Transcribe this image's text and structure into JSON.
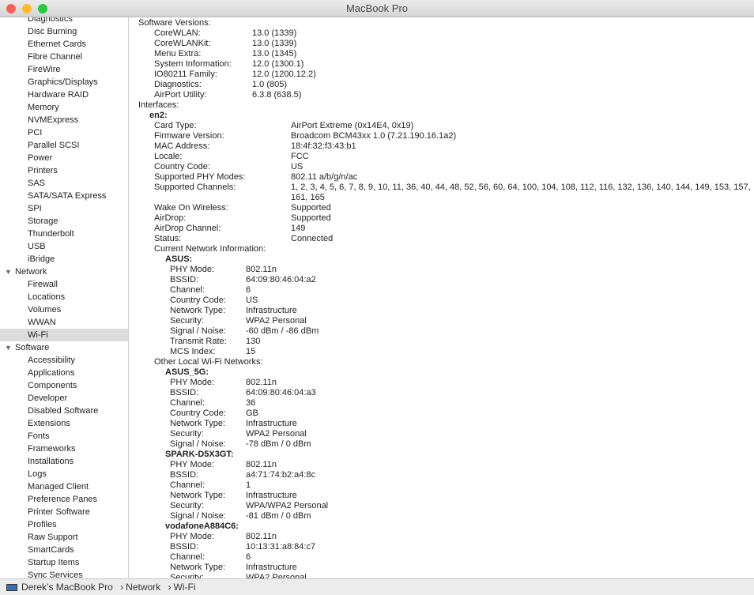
{
  "window": {
    "title": "MacBook Pro",
    "traffic": {
      "close": "#fc5f57",
      "minimize": "#fdbc2e",
      "zoom": "#28c840"
    }
  },
  "sidebar": {
    "items": [
      {
        "label": "Diagnostics",
        "level": 1
      },
      {
        "label": "Disc Burning",
        "level": 1
      },
      {
        "label": "Ethernet Cards",
        "level": 1
      },
      {
        "label": "Fibre Channel",
        "level": 1
      },
      {
        "label": "FireWire",
        "level": 1
      },
      {
        "label": "Graphics/Displays",
        "level": 1
      },
      {
        "label": "Hardware RAID",
        "level": 1
      },
      {
        "label": "Memory",
        "level": 1
      },
      {
        "label": "NVMExpress",
        "level": 1
      },
      {
        "label": "PCI",
        "level": 1
      },
      {
        "label": "Parallel SCSI",
        "level": 1
      },
      {
        "label": "Power",
        "level": 1
      },
      {
        "label": "Printers",
        "level": 1
      },
      {
        "label": "SAS",
        "level": 1
      },
      {
        "label": "SATA/SATA Express",
        "level": 1
      },
      {
        "label": "SPI",
        "level": 1
      },
      {
        "label": "Storage",
        "level": 1
      },
      {
        "label": "Thunderbolt",
        "level": 1
      },
      {
        "label": "USB",
        "level": 1
      },
      {
        "label": "iBridge",
        "level": 1
      },
      {
        "label": "Network",
        "level": 0
      },
      {
        "label": "Firewall",
        "level": 1
      },
      {
        "label": "Locations",
        "level": 1
      },
      {
        "label": "Volumes",
        "level": 1
      },
      {
        "label": "WWAN",
        "level": 1
      },
      {
        "label": "Wi-Fi",
        "level": 1,
        "selected": true
      },
      {
        "label": "Software",
        "level": 0
      },
      {
        "label": "Accessibility",
        "level": 1
      },
      {
        "label": "Applications",
        "level": 1
      },
      {
        "label": "Components",
        "level": 1
      },
      {
        "label": "Developer",
        "level": 1
      },
      {
        "label": "Disabled Software",
        "level": 1
      },
      {
        "label": "Extensions",
        "level": 1
      },
      {
        "label": "Fonts",
        "level": 1
      },
      {
        "label": "Frameworks",
        "level": 1
      },
      {
        "label": "Installations",
        "level": 1
      },
      {
        "label": "Logs",
        "level": 1
      },
      {
        "label": "Managed Client",
        "level": 1
      },
      {
        "label": "Preference Panes",
        "level": 1
      },
      {
        "label": "Printer Software",
        "level": 1
      },
      {
        "label": "Profiles",
        "level": 1
      },
      {
        "label": "Raw Support",
        "level": 1
      },
      {
        "label": "SmartCards",
        "level": 1
      },
      {
        "label": "Startup Items",
        "level": 1
      },
      {
        "label": "Sync Services",
        "level": 1
      }
    ]
  },
  "content": {
    "rows": [
      {
        "label": "Software Versions:",
        "level": 0
      },
      {
        "label": "CoreWLAN:",
        "value": "13.0 (1339)",
        "level": 2,
        "col": "a"
      },
      {
        "label": "CoreWLANKit:",
        "value": "13.0 (1339)",
        "level": 2,
        "col": "a"
      },
      {
        "label": "Menu Extra:",
        "value": "13.0 (1345)",
        "level": 2,
        "col": "a"
      },
      {
        "label": "System Information:",
        "value": "12.0 (1300.1)",
        "level": 2,
        "col": "a"
      },
      {
        "label": "IO80211 Family:",
        "value": "12.0 (1200.12.2)",
        "level": 2,
        "col": "a"
      },
      {
        "label": "Diagnostics:",
        "value": "1.0 (805)",
        "level": 2,
        "col": "a"
      },
      {
        "label": "AirPort Utility:",
        "value": "6.3.8 (638.5)",
        "level": 2,
        "col": "a"
      },
      {
        "label": "Interfaces:",
        "level": 0
      },
      {
        "label": "en2:",
        "level": 1,
        "bold": true
      },
      {
        "label": "Card Type:",
        "value": "AirPort Extreme  (0x14E4, 0x19)",
        "level": 2,
        "col": "b"
      },
      {
        "label": "Firmware Version:",
        "value": "Broadcom BCM43xx 1.0 (7.21.190.16.1a2)",
        "level": 2,
        "col": "b"
      },
      {
        "label": "MAC Address:",
        "value": "18:4f:32:f3:43:b1",
        "level": 2,
        "col": "b"
      },
      {
        "label": "Locale:",
        "value": "FCC",
        "level": 2,
        "col": "b"
      },
      {
        "label": "Country Code:",
        "value": "US",
        "level": 2,
        "col": "b"
      },
      {
        "label": "Supported PHY Modes:",
        "value": "802.11 a/b/g/n/ac",
        "level": 2,
        "col": "b"
      },
      {
        "label": "Supported Channels:",
        "value": "1, 2, 3, 4, 5, 6, 7, 8, 9, 10, 11, 36, 40, 44, 48, 52, 56, 60, 64, 100, 104, 108, 112, 116, 132, 136, 140, 144, 149, 153, 157, 161, 165",
        "level": 2,
        "col": "b",
        "lines": 2
      },
      {
        "label": "Wake On Wireless:",
        "value": "Supported",
        "level": 2,
        "col": "b"
      },
      {
        "label": "AirDrop:",
        "value": "Supported",
        "level": 2,
        "col": "b"
      },
      {
        "label": "AirDrop Channel:",
        "value": "149",
        "level": 2,
        "col": "b"
      },
      {
        "label": "Status:",
        "value": "Connected",
        "level": 2,
        "col": "b"
      },
      {
        "label": "Current Network Information:",
        "level": 2
      },
      {
        "label": "ASUS:",
        "level": 3,
        "bold": true
      },
      {
        "label": "PHY Mode:",
        "value": "802.11n",
        "level": 4,
        "col": "c"
      },
      {
        "label": "BSSID:",
        "value": "64:09:80:46:04:a2",
        "level": 4,
        "col": "c"
      },
      {
        "label": "Channel:",
        "value": "6",
        "level": 4,
        "col": "c"
      },
      {
        "label": "Country Code:",
        "value": "US",
        "level": 4,
        "col": "c"
      },
      {
        "label": "Network Type:",
        "value": "Infrastructure",
        "level": 4,
        "col": "c"
      },
      {
        "label": "Security:",
        "value": "WPA2 Personal",
        "level": 4,
        "col": "c"
      },
      {
        "label": "Signal / Noise:",
        "value": "-60 dBm / -86 dBm",
        "level": 4,
        "col": "c"
      },
      {
        "label": "Transmit Rate:",
        "value": "130",
        "level": 4,
        "col": "c"
      },
      {
        "label": "MCS Index:",
        "value": "15",
        "level": 4,
        "col": "c"
      },
      {
        "label": "Other Local Wi-Fi Networks:",
        "level": 2
      },
      {
        "label": "ASUS_5G:",
        "level": 3,
        "bold": true
      },
      {
        "label": "PHY Mode:",
        "value": "802.11n",
        "level": 4,
        "col": "c"
      },
      {
        "label": "BSSID:",
        "value": "64:09:80:46:04:a3",
        "level": 4,
        "col": "c"
      },
      {
        "label": "Channel:",
        "value": "36",
        "level": 4,
        "col": "c"
      },
      {
        "label": "Country Code:",
        "value": "GB",
        "level": 4,
        "col": "c"
      },
      {
        "label": "Network Type:",
        "value": "Infrastructure",
        "level": 4,
        "col": "c"
      },
      {
        "label": "Security:",
        "value": "WPA2 Personal",
        "level": 4,
        "col": "c"
      },
      {
        "label": "Signal / Noise:",
        "value": "-78 dBm / 0 dBm",
        "level": 4,
        "col": "c"
      },
      {
        "label": "SPARK-D5X3GT:",
        "level": 3,
        "bold": true
      },
      {
        "label": "PHY Mode:",
        "value": "802.11n",
        "level": 4,
        "col": "c"
      },
      {
        "label": "BSSID:",
        "value": "a4:71:74:b2:a4:8c",
        "level": 4,
        "col": "c"
      },
      {
        "label": "Channel:",
        "value": "1",
        "level": 4,
        "col": "c"
      },
      {
        "label": "Network Type:",
        "value": "Infrastructure",
        "level": 4,
        "col": "c"
      },
      {
        "label": "Security:",
        "value": "WPA/WPA2 Personal",
        "level": 4,
        "col": "c"
      },
      {
        "label": "Signal / Noise:",
        "value": "-81 dBm / 0 dBm",
        "level": 4,
        "col": "c"
      },
      {
        "label": "vodafoneA884C6:",
        "level": 3,
        "bold": true
      },
      {
        "label": "PHY Mode:",
        "value": "802.11n",
        "level": 4,
        "col": "c"
      },
      {
        "label": "BSSID:",
        "value": "10:13:31:a8:84:c7",
        "level": 4,
        "col": "c"
      },
      {
        "label": "Channel:",
        "value": "6",
        "level": 4,
        "col": "c"
      },
      {
        "label": "Network Type:",
        "value": "Infrastructure",
        "level": 4,
        "col": "c"
      },
      {
        "label": "Security:",
        "value": "WPA2 Personal",
        "level": 4,
        "col": "c"
      }
    ]
  },
  "statusbar": {
    "computer": "Derek’s MacBook Pro",
    "separator": "›",
    "crumbs": [
      "Network",
      "Wi-Fi"
    ],
    "icon": "laptop-icon"
  }
}
